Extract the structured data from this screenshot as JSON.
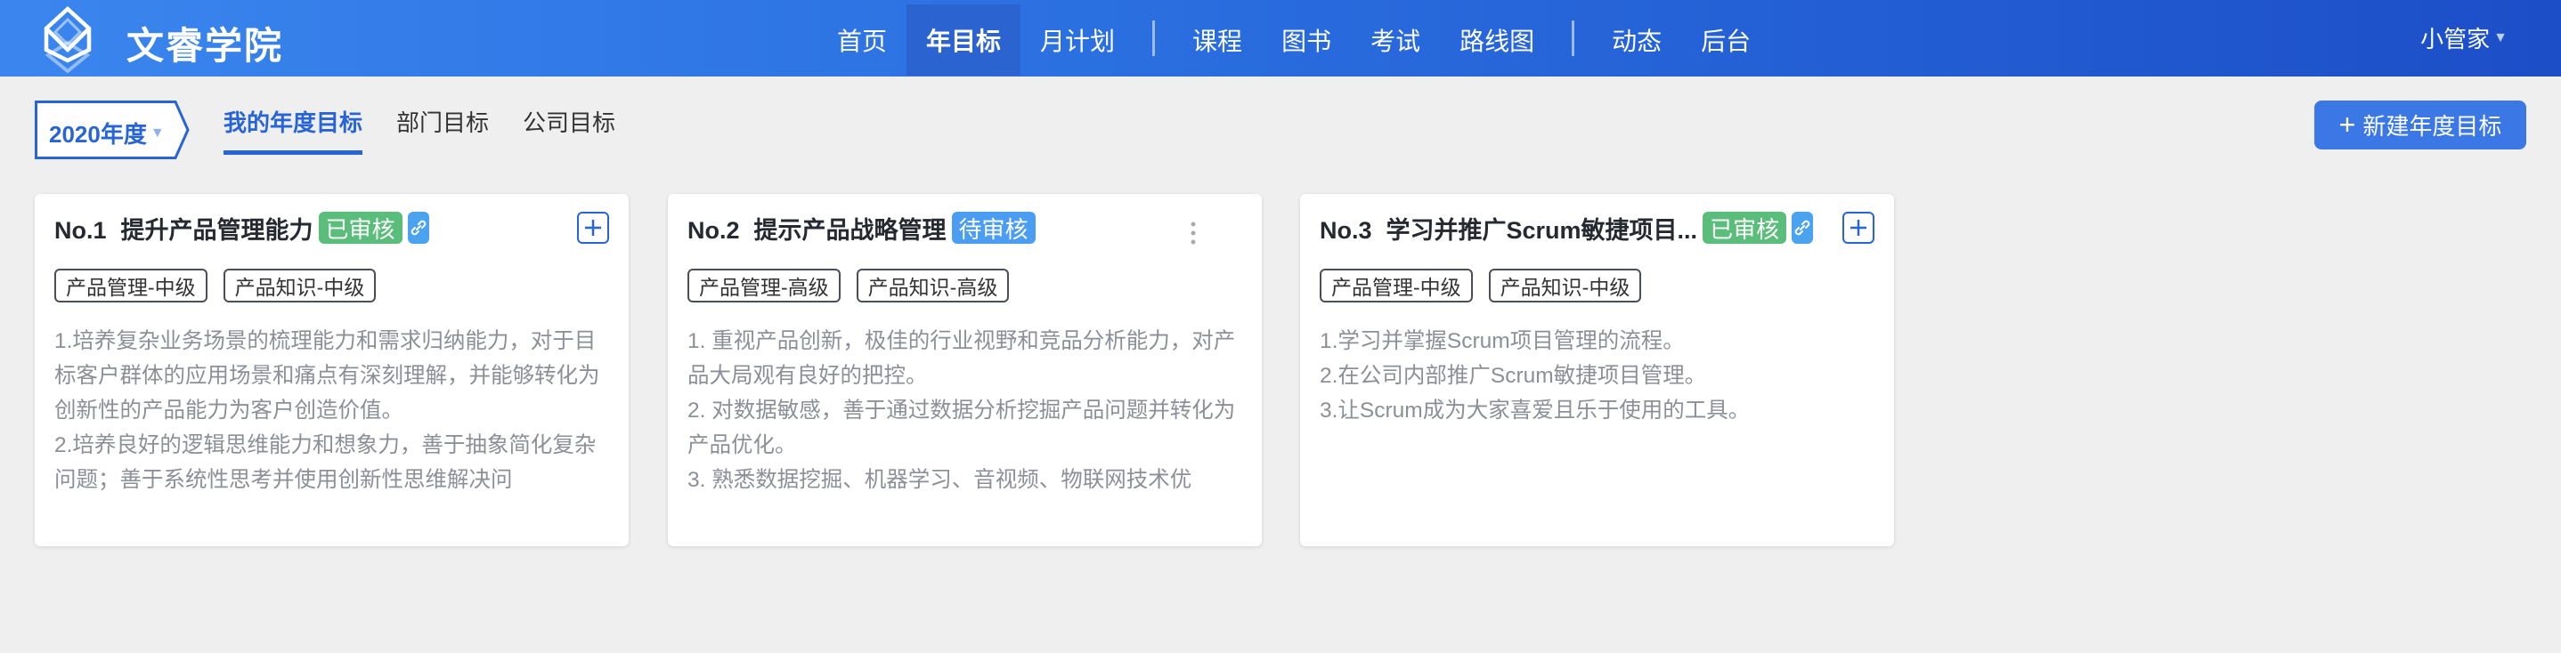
{
  "header": {
    "brand": "文睿学院",
    "nav": [
      "首页",
      "年目标",
      "月计划",
      "课程",
      "图书",
      "考试",
      "路线图",
      "动态",
      "后台"
    ],
    "active_nav": "年目标",
    "user": "小管家"
  },
  "toolbar": {
    "year": "2020年度",
    "tabs": [
      "我的年度目标",
      "部门目标",
      "公司目标"
    ],
    "new_button": "新建年度目标"
  },
  "colors": {
    "accent": "#2765d6",
    "approved": "#5bbd7a",
    "pending": "#4a9df0"
  },
  "cards": [
    {
      "no": "No.1",
      "title": "提升产品管理能力",
      "status": "已审核",
      "tags": [
        "产品管理-中级",
        "产品知识-中级"
      ],
      "lines": [
        "1.培养复杂业务场景的梳理能力和需求归纳能力，对于目标客户群体的应用场景和痛点有深刻理解，并能够转化为创新性的产品能力为客户创造价值。",
        "2.培养良好的逻辑思维能力和想象力，善于抽象简化复杂问题；善于系统性思考并使用创新性思维解决问"
      ]
    },
    {
      "no": "No.2",
      "title": "提示产品战略管理",
      "status": "待审核",
      "tags": [
        "产品管理-高级",
        "产品知识-高级"
      ],
      "lines": [
        "1. 重视产品创新，极佳的行业视野和竞品分析能力，对产品大局观有良好的把控。",
        "2. 对数据敏感，善于通过数据分析挖掘产品问题并转化为产品优化。",
        "3. 熟悉数据挖掘、机器学习、音视频、物联网技术优"
      ]
    },
    {
      "no": "No.3",
      "title": "学习并推广Scrum敏捷项目...",
      "status": "已审核",
      "tags": [
        "产品管理-中级",
        "产品知识-中级"
      ],
      "lines": [
        "1.学习并掌握Scrum项目管理的流程。",
        "2.在公司内部推广Scrum敏捷项目管理。",
        "3.让Scrum成为大家喜爱且乐于使用的工具。"
      ]
    }
  ]
}
